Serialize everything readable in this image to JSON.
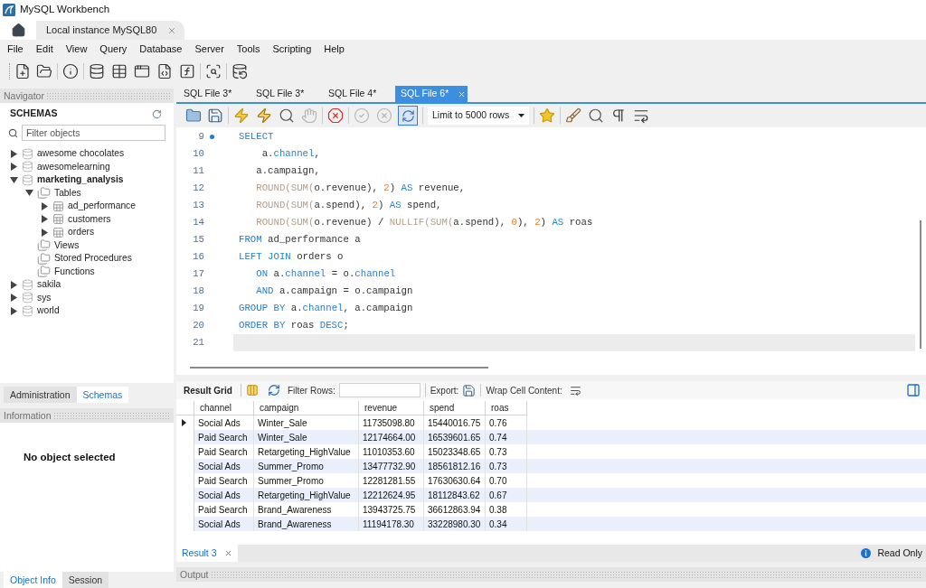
{
  "window": {
    "title": "MySQL Workbench"
  },
  "connection_tab": {
    "label": "Local instance MySQL80"
  },
  "menu": [
    "File",
    "Edit",
    "View",
    "Query",
    "Database",
    "Server",
    "Tools",
    "Scripting",
    "Help"
  ],
  "navigator": {
    "title": "Navigator",
    "section": "SCHEMAS",
    "filter": {
      "placeholder": "Filter objects"
    },
    "tree": [
      {
        "label": "awesome chocolates",
        "kind": "schema",
        "expanded": false,
        "active": false
      },
      {
        "label": "awesomelearning",
        "kind": "schema",
        "expanded": false,
        "active": false
      },
      {
        "label": "marketing_analysis",
        "kind": "schema",
        "expanded": true,
        "active": true,
        "children": [
          {
            "label": "Tables",
            "kind": "folder",
            "expanded": true,
            "children": [
              {
                "label": "ad_performance",
                "kind": "table",
                "expanded": false
              },
              {
                "label": "customers",
                "kind": "table",
                "expanded": false
              },
              {
                "label": "orders",
                "kind": "table",
                "expanded": false
              }
            ]
          },
          {
            "label": "Views",
            "kind": "folder"
          },
          {
            "label": "Stored Procedures",
            "kind": "folder"
          },
          {
            "label": "Functions",
            "kind": "folder"
          }
        ]
      },
      {
        "label": "sakila",
        "kind": "schema",
        "expanded": false,
        "active": false
      },
      {
        "label": "sys",
        "kind": "schema",
        "expanded": false,
        "active": false
      },
      {
        "label": "world",
        "kind": "schema",
        "expanded": false,
        "active": false
      }
    ]
  },
  "panel_tabs": [
    {
      "label": "Administration",
      "selected": false
    },
    {
      "label": "Schemas",
      "selected": true
    }
  ],
  "information": {
    "title": "Information",
    "message": "No object selected"
  },
  "info_tabs": [
    {
      "label": "Object Info",
      "selected": true
    },
    {
      "label": "Session",
      "selected": false
    }
  ],
  "editor_tabs": [
    {
      "label": "SQL File 3*",
      "selected": false
    },
    {
      "label": "SQL File 3*",
      "selected": false
    },
    {
      "label": "SQL File 4*",
      "selected": false
    },
    {
      "label": "SQL File 6*",
      "selected": true
    }
  ],
  "editor_toolbar": {
    "auto_commit": true,
    "limit": "Limit to 5000 rows"
  },
  "code": {
    "lines": [
      {
        "number": "9",
        "marker": true,
        "current": false,
        "tokens": [
          {
            "text": "SELECT",
            "kind": "keyword"
          }
        ]
      },
      {
        "number": "10",
        "marker": false,
        "current": false,
        "tokens": [
          {
            "text": "    a.",
            "kind": "plain"
          },
          {
            "text": "channel",
            "kind": "keyword"
          },
          {
            "text": ",",
            "kind": "plain"
          }
        ]
      },
      {
        "number": "11",
        "marker": false,
        "current": false,
        "tokens": [
          {
            "text": "   a.campaign,",
            "kind": "plain"
          }
        ]
      },
      {
        "number": "12",
        "marker": false,
        "current": false,
        "tokens": [
          {
            "text": "   ROUND(SUM(",
            "kind": "function"
          },
          {
            "text": "o.revenue), ",
            "kind": "plain"
          },
          {
            "text": "2",
            "kind": "number"
          },
          {
            "text": ") ",
            "kind": "plain"
          },
          {
            "text": "AS",
            "kind": "keyword"
          },
          {
            "text": " revenue,",
            "kind": "plain"
          }
        ]
      },
      {
        "number": "13",
        "marker": false,
        "current": false,
        "tokens": [
          {
            "text": "   ROUND(SUM(",
            "kind": "function"
          },
          {
            "text": "a.spend), ",
            "kind": "plain"
          },
          {
            "text": "2",
            "kind": "number"
          },
          {
            "text": ") ",
            "kind": "plain"
          },
          {
            "text": "AS",
            "kind": "keyword"
          },
          {
            "text": " spend,",
            "kind": "plain"
          }
        ]
      },
      {
        "number": "14",
        "marker": false,
        "current": false,
        "tokens": [
          {
            "text": "   ROUND(SUM(",
            "kind": "function"
          },
          {
            "text": "o.revenue) / ",
            "kind": "plain"
          },
          {
            "text": "NULLIF(SUM(",
            "kind": "function"
          },
          {
            "text": "a.spend), ",
            "kind": "plain"
          },
          {
            "text": "0",
            "kind": "number"
          },
          {
            "text": "), ",
            "kind": "plain"
          },
          {
            "text": "2",
            "kind": "number"
          },
          {
            "text": ") ",
            "kind": "plain"
          },
          {
            "text": "AS",
            "kind": "keyword"
          },
          {
            "text": " roas",
            "kind": "plain"
          }
        ]
      },
      {
        "number": "15",
        "marker": false,
        "current": false,
        "tokens": [
          {
            "text": "FROM",
            "kind": "keyword"
          },
          {
            "text": " ad_performance a",
            "kind": "plain"
          }
        ]
      },
      {
        "number": "16",
        "marker": false,
        "current": false,
        "tokens": [
          {
            "text": "LEFT JOIN",
            "kind": "keyword"
          },
          {
            "text": " orders o",
            "kind": "plain"
          }
        ]
      },
      {
        "number": "17",
        "marker": false,
        "current": false,
        "tokens": [
          {
            "text": "   ON",
            "kind": "keyword"
          },
          {
            "text": " a.",
            "kind": "plain"
          },
          {
            "text": "channel",
            "kind": "keyword"
          },
          {
            "text": " = o.",
            "kind": "plain"
          },
          {
            "text": "channel",
            "kind": "keyword"
          }
        ]
      },
      {
        "number": "18",
        "marker": false,
        "current": false,
        "tokens": [
          {
            "text": "   AND",
            "kind": "keyword"
          },
          {
            "text": " a.campaign = o.campaign",
            "kind": "plain"
          }
        ]
      },
      {
        "number": "19",
        "marker": false,
        "current": false,
        "tokens": [
          {
            "text": "GROUP BY",
            "kind": "keyword"
          },
          {
            "text": " a.",
            "kind": "plain"
          },
          {
            "text": "channel",
            "kind": "keyword"
          },
          {
            "text": ", a.campaign",
            "kind": "plain"
          }
        ]
      },
      {
        "number": "20",
        "marker": false,
        "current": false,
        "tokens": [
          {
            "text": "ORDER BY",
            "kind": "keyword"
          },
          {
            "text": " roas ",
            "kind": "plain"
          },
          {
            "text": "DESC",
            "kind": "keyword"
          },
          {
            "text": ";",
            "kind": "plain"
          }
        ]
      },
      {
        "number": "21",
        "marker": false,
        "current": true
      }
    ]
  },
  "result_toolbar": {
    "view": "Result Grid",
    "filter_label": "Filter Rows:",
    "export_label": "Export:",
    "wrap_label": "Wrap Cell Content:"
  },
  "result": {
    "columns": [
      "channel",
      "campaign",
      "revenue",
      "spend",
      "roas"
    ],
    "rows": [
      {
        "selected": true,
        "cells": [
          "Social Ads",
          "Winter_Sale",
          "11735098.80",
          "15440016.75",
          "0.76"
        ]
      },
      {
        "selected": false,
        "cells": [
          "Paid Search",
          "Winter_Sale",
          "12174664.00",
          "16539601.65",
          "0.74"
        ]
      },
      {
        "selected": false,
        "cells": [
          "Paid Search",
          "Retargeting_HighValue",
          "11010353.60",
          "15023348.65",
          "0.73"
        ]
      },
      {
        "selected": false,
        "cells": [
          "Social Ads",
          "Summer_Promo",
          "13477732.90",
          "18561812.16",
          "0.73"
        ]
      },
      {
        "selected": false,
        "cells": [
          "Paid Search",
          "Summer_Promo",
          "12281281.55",
          "17630630.64",
          "0.70"
        ]
      },
      {
        "selected": false,
        "cells": [
          "Social Ads",
          "Retargeting_HighValue",
          "12212624.95",
          "18112843.62",
          "0.67"
        ]
      },
      {
        "selected": false,
        "cells": [
          "Paid Search",
          "Brand_Awareness",
          "13943725.75",
          "36612863.94",
          "0.38"
        ]
      },
      {
        "selected": false,
        "cells": [
          "Social Ads",
          "Brand_Awareness",
          "11194178.30",
          "33228980.30",
          "0.34"
        ]
      }
    ]
  },
  "result_tabs": [
    {
      "label": "Result 3"
    }
  ],
  "status": "Read Only",
  "output": {
    "title": "Output"
  }
}
